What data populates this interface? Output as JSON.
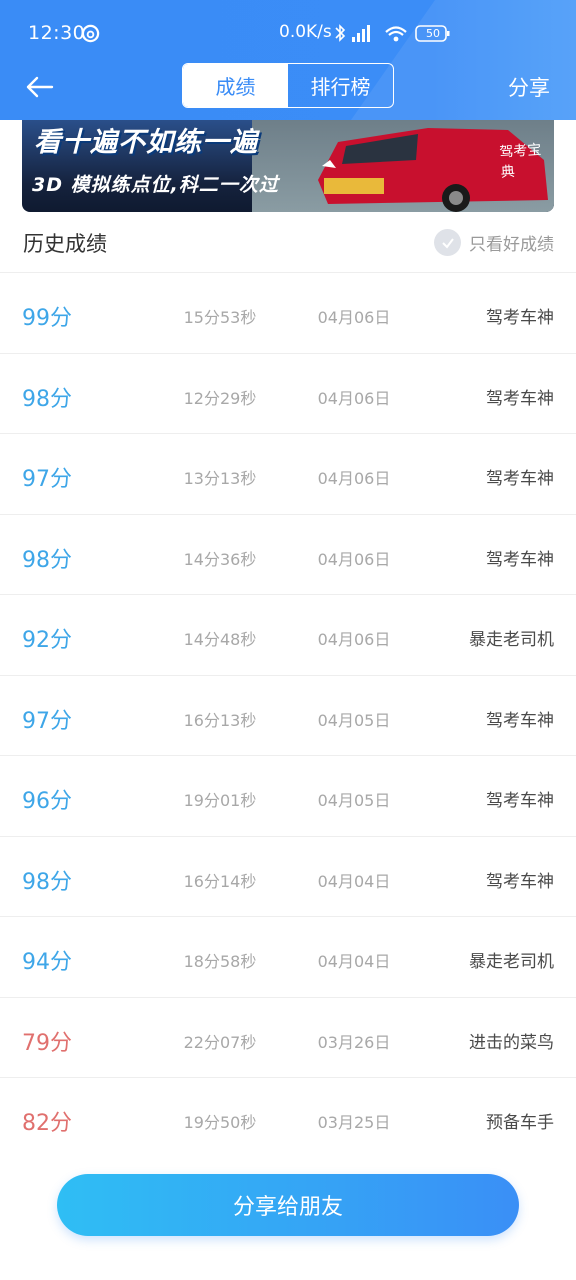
{
  "status_bar": {
    "time": "12:30",
    "network_speed": "0.0K/s",
    "battery": "50"
  },
  "header": {
    "tabs": [
      {
        "label": "成绩",
        "active": true
      },
      {
        "label": "排行榜",
        "active": false
      }
    ],
    "share_label": "分享"
  },
  "banner": {
    "line1": "看十遍不如练一遍",
    "line2": "3D 模拟练点位,科二一次过",
    "car_text": "驾考宝典"
  },
  "section": {
    "title": "历史成绩",
    "filter_label": "只看好成绩"
  },
  "records": [
    {
      "score": "99分",
      "duration": "15分53秒",
      "date": "04月06日",
      "rank": "驾考车神",
      "pass": true
    },
    {
      "score": "98分",
      "duration": "12分29秒",
      "date": "04月06日",
      "rank": "驾考车神",
      "pass": true
    },
    {
      "score": "97分",
      "duration": "13分13秒",
      "date": "04月06日",
      "rank": "驾考车神",
      "pass": true
    },
    {
      "score": "98分",
      "duration": "14分36秒",
      "date": "04月06日",
      "rank": "驾考车神",
      "pass": true
    },
    {
      "score": "92分",
      "duration": "14分48秒",
      "date": "04月06日",
      "rank": "暴走老司机",
      "pass": true
    },
    {
      "score": "97分",
      "duration": "16分13秒",
      "date": "04月05日",
      "rank": "驾考车神",
      "pass": true
    },
    {
      "score": "96分",
      "duration": "19分01秒",
      "date": "04月05日",
      "rank": "驾考车神",
      "pass": true
    },
    {
      "score": "98分",
      "duration": "16分14秒",
      "date": "04月04日",
      "rank": "驾考车神",
      "pass": true
    },
    {
      "score": "94分",
      "duration": "18分58秒",
      "date": "04月04日",
      "rank": "暴走老司机",
      "pass": true
    },
    {
      "score": "79分",
      "duration": "22分07秒",
      "date": "03月26日",
      "rank": "进击的菜鸟",
      "pass": false
    },
    {
      "score": "82分",
      "duration": "19分50秒",
      "date": "03月25日",
      "rank": "预备车手",
      "pass": false
    }
  ],
  "footer": {
    "share_button_label": "分享给朋友"
  },
  "colors": {
    "header_blue": "#3a8cf6",
    "score_good": "#3ea6e8",
    "score_bad": "#e0706e"
  },
  "icons": {
    "back": "arrow-left-icon",
    "check": "check-circle-icon",
    "wifi": "wifi-icon",
    "bluetooth": "bluetooth-icon",
    "signal": "signal-icon",
    "battery": "battery-icon"
  }
}
